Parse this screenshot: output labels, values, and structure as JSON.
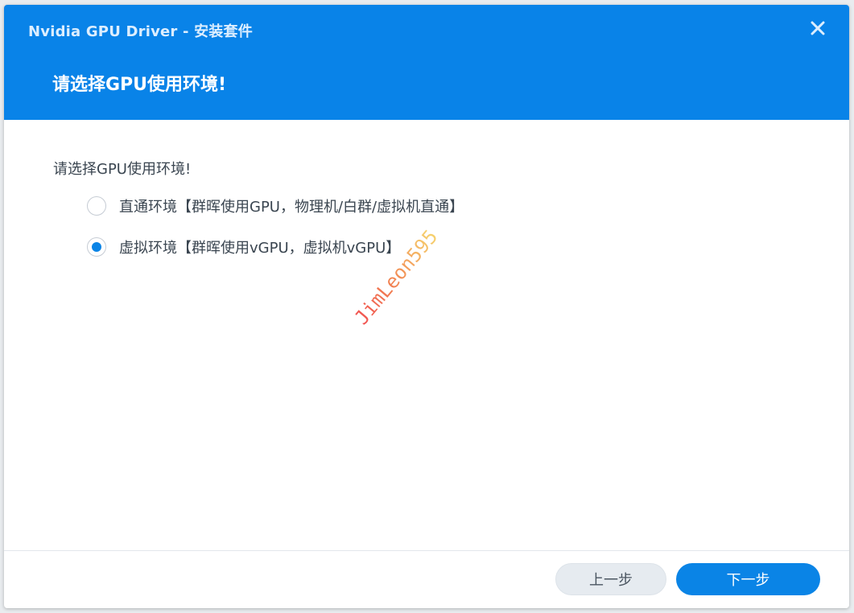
{
  "window": {
    "title": "Nvidia GPU Driver - 安装套件",
    "close_icon": "close-icon"
  },
  "header": {
    "step_title": "请选择GPU使用环境!"
  },
  "content": {
    "prompt": "请选择GPU使用环境!",
    "options": [
      {
        "label": "直通环境【群晖使用GPU，物理机/白群/虚拟机直通】",
        "selected": false
      },
      {
        "label": "虚拟环境【群晖使用vGPU，虚拟机vGPU】",
        "selected": true
      }
    ],
    "watermark": "JimLeon595"
  },
  "footer": {
    "prev_label": "上一步",
    "next_label": "下一步"
  },
  "colors": {
    "accent": "#0983e8",
    "primary_button": "#0a84e6",
    "secondary_button": "#e6ebf0"
  }
}
